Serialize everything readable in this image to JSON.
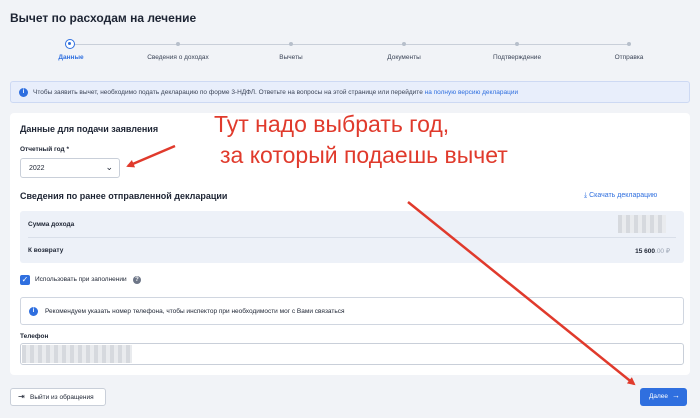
{
  "page": {
    "title": "Вычет по расходам на лечение"
  },
  "stepper": {
    "steps": [
      {
        "label": "Данные",
        "active": true
      },
      {
        "label": "Сведения о доходах",
        "active": false
      },
      {
        "label": "Вычеты",
        "active": false
      },
      {
        "label": "Документы",
        "active": false
      },
      {
        "label": "Подтверждение",
        "active": false
      },
      {
        "label": "Отправка",
        "active": false
      }
    ]
  },
  "info_banner": {
    "text": "Чтобы заявить вычет, необходимо подать декларацию по форме 3-НДФЛ. Ответьте на вопросы на этой странице или перейдите",
    "link": "на полную версию декларации"
  },
  "application": {
    "title": "Данные для подачи заявления",
    "year_label": "Отчетный год *",
    "year_value": "2022"
  },
  "prev_declaration": {
    "title": "Сведения по ранее отправленной декларации",
    "download_label": "Скачать декларацию",
    "rows": [
      {
        "label": "Сумма дохода",
        "value": ""
      },
      {
        "label": "К возврату",
        "value": "15 600",
        "decimals": ".00 ₽"
      }
    ]
  },
  "autofill": {
    "checked": true,
    "label": "Использовать при заполнении",
    "help_icon": "?"
  },
  "phone": {
    "notice": "Рекомендуем указать номер телефона, чтобы инспектор при необходимости мог с Вами связаться",
    "label": "Телефон",
    "value": ""
  },
  "footer": {
    "exit_label": "Выйти из обращения",
    "next_label": "Далее"
  },
  "annotation": {
    "line1": "Тут надо выбрать год,",
    "line2": "за который подаешь вычет",
    "color": "#e03a2c"
  },
  "colors": {
    "accent": "#2f6fdf",
    "background": "#f1f3f7",
    "annotation": "#e03a2c"
  }
}
